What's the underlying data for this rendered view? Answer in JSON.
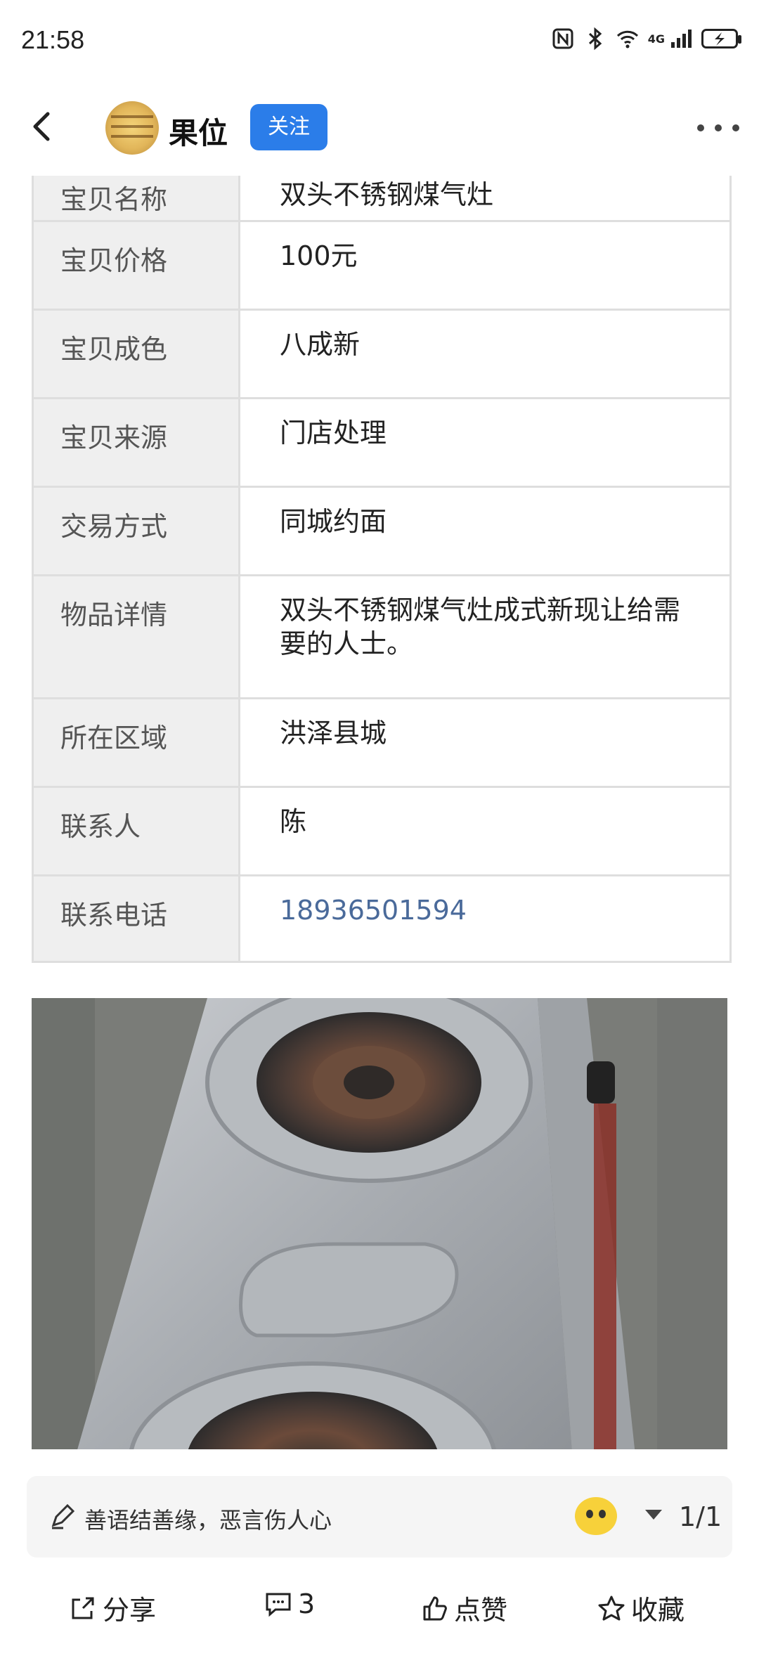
{
  "status_bar": {
    "time": "21:58",
    "network": "4G"
  },
  "header": {
    "user_name": "果位",
    "follow_label": "关注"
  },
  "table": {
    "rows": [
      {
        "label": "宝贝名称",
        "value": "双头不锈钢煤气灶"
      },
      {
        "label": "宝贝价格",
        "value": "100元"
      },
      {
        "label": "宝贝成色",
        "value": "八成新"
      },
      {
        "label": "宝贝来源",
        "value": "门店处理"
      },
      {
        "label": "交易方式",
        "value": "同城约面"
      },
      {
        "label": "物品详情",
        "value": "双头不锈钢煤气灶成式新现让给需要的人士。"
      },
      {
        "label": "所在区域",
        "value": "洪泽县城"
      },
      {
        "label": "联系人",
        "value": "陈"
      },
      {
        "label": "联系电话",
        "value": "18936501594"
      }
    ]
  },
  "comment_bar": {
    "placeholder": "善语结善缘，恶言伤人心",
    "page": "1/1"
  },
  "actions": {
    "share": "分享",
    "comments": "3",
    "like": "点赞",
    "favorite": "收藏"
  },
  "colors": {
    "accent": "#2b7de9",
    "phone_link": "#4a6a9a"
  }
}
